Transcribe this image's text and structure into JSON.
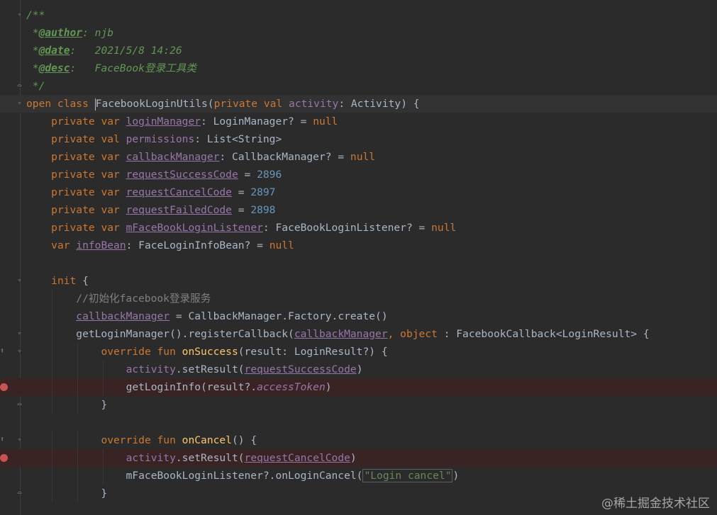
{
  "editor": {
    "lines": [
      {
        "gutter": "fold-top",
        "tokens": [
          [
            "doc",
            "/**"
          ]
        ]
      },
      {
        "tokens": [
          [
            "doc",
            " *"
          ],
          [
            "doctag",
            "@author"
          ],
          [
            "doc",
            ": njb"
          ]
        ]
      },
      {
        "tokens": [
          [
            "doc",
            " *"
          ],
          [
            "doctag",
            "@date"
          ],
          [
            "doc",
            ":   2021/5/8 14:26"
          ]
        ]
      },
      {
        "tokens": [
          [
            "doc",
            " *"
          ],
          [
            "doctag",
            "@desc"
          ],
          [
            "doc",
            ":   FaceBook登录工具类"
          ]
        ]
      },
      {
        "gutter": "fold-bottom",
        "tokens": [
          [
            "doc",
            " */"
          ]
        ]
      },
      {
        "gutter": "fold-top",
        "caret": true,
        "tokens": [
          [
            "kw",
            "open class "
          ],
          [
            "caret",
            ""
          ],
          [
            "plain",
            "FacebookLoginUtils("
          ],
          [
            "kw",
            "private val "
          ],
          [
            "fld",
            "activity"
          ],
          [
            "plain",
            ": Activity) {"
          ]
        ]
      },
      {
        "tokens": [
          [
            "plain",
            "    "
          ],
          [
            "kw",
            "private var "
          ],
          [
            "fldu",
            "loginManager"
          ],
          [
            "plain",
            ": LoginManager? = "
          ],
          [
            "kw",
            "null"
          ]
        ]
      },
      {
        "tokens": [
          [
            "plain",
            "    "
          ],
          [
            "kw",
            "private val "
          ],
          [
            "fld",
            "permissions"
          ],
          [
            "plain",
            ": List<String>"
          ]
        ]
      },
      {
        "tokens": [
          [
            "plain",
            "    "
          ],
          [
            "kw",
            "private var "
          ],
          [
            "fldu",
            "callbackManager"
          ],
          [
            "plain",
            ": CallbackManager? = "
          ],
          [
            "kw",
            "null"
          ]
        ]
      },
      {
        "tokens": [
          [
            "plain",
            "    "
          ],
          [
            "kw",
            "private var "
          ],
          [
            "fldu",
            "requestSuccessCode"
          ],
          [
            "plain",
            " = "
          ],
          [
            "num",
            "2896"
          ]
        ]
      },
      {
        "tokens": [
          [
            "plain",
            "    "
          ],
          [
            "kw",
            "private var "
          ],
          [
            "fldu",
            "requestCancelCode"
          ],
          [
            "plain",
            " = "
          ],
          [
            "num",
            "2897"
          ]
        ]
      },
      {
        "tokens": [
          [
            "plain",
            "    "
          ],
          [
            "kw",
            "private var "
          ],
          [
            "fldu",
            "requestFailedCode"
          ],
          [
            "plain",
            " = "
          ],
          [
            "num",
            "2898"
          ]
        ]
      },
      {
        "tokens": [
          [
            "plain",
            "    "
          ],
          [
            "kw",
            "private var "
          ],
          [
            "fldu",
            "mFaceBookLoginListener"
          ],
          [
            "plain",
            ": FaceBookLoginListener? = "
          ],
          [
            "kw",
            "null"
          ]
        ]
      },
      {
        "tokens": [
          [
            "plain",
            "    "
          ],
          [
            "kw",
            "var "
          ],
          [
            "fldu",
            "infoBean"
          ],
          [
            "plain",
            ": FaceLoginInfoBean? = "
          ],
          [
            "kw",
            "null"
          ]
        ]
      },
      {
        "tokens": []
      },
      {
        "gutter": "fold-top",
        "tokens": [
          [
            "plain",
            "    "
          ],
          [
            "kw",
            "init"
          ],
          [
            "plain",
            " {"
          ]
        ]
      },
      {
        "tokens": [
          [
            "plain",
            "        "
          ],
          [
            "cmt",
            "//初始化facebook登录服务"
          ]
        ]
      },
      {
        "tokens": [
          [
            "plain",
            "        "
          ],
          [
            "fldu",
            "callbackManager"
          ],
          [
            "plain",
            " = CallbackManager.Factory.create()"
          ]
        ]
      },
      {
        "gutter": "fold-top",
        "tokens": [
          [
            "plain",
            "        getLoginManager().registerCallback("
          ],
          [
            "fldu",
            "callbackManager"
          ],
          [
            "kw",
            ", object "
          ],
          [
            "plain",
            ": FacebookCallback<LoginResult> {"
          ]
        ]
      },
      {
        "gutter": "fold-top",
        "override": true,
        "tokens": [
          [
            "plain",
            "            "
          ],
          [
            "kw",
            "override fun "
          ],
          [
            "fn",
            "onSuccess"
          ],
          [
            "plain",
            "(result: LoginResult?) {"
          ]
        ]
      },
      {
        "tokens": [
          [
            "plain",
            "                "
          ],
          [
            "fld",
            "activity"
          ],
          [
            "plain",
            ".setResult("
          ],
          [
            "fldu",
            "requestSuccessCode"
          ],
          [
            "plain",
            ")"
          ]
        ]
      },
      {
        "breakpoint": true,
        "tokens": [
          [
            "plain",
            "                getLoginInfo(result?."
          ],
          [
            "fldit",
            "accessToken"
          ],
          [
            "plain",
            ")"
          ]
        ]
      },
      {
        "gutter": "fold-bottom",
        "tokens": [
          [
            "plain",
            "            }"
          ]
        ]
      },
      {
        "tokens": []
      },
      {
        "gutter": "fold-top",
        "override": true,
        "tokens": [
          [
            "plain",
            "            "
          ],
          [
            "kw",
            "override fun "
          ],
          [
            "fn",
            "onCancel"
          ],
          [
            "plain",
            "() {"
          ]
        ]
      },
      {
        "breakpoint": true,
        "tokens": [
          [
            "plain",
            "                "
          ],
          [
            "fld",
            "activity"
          ],
          [
            "plain",
            ".setResult("
          ],
          [
            "fldu",
            "requestCancelCode"
          ],
          [
            "plain",
            ")"
          ]
        ]
      },
      {
        "tokens": [
          [
            "plain",
            "                mFaceBookLoginListener?.onLoginCancel("
          ],
          [
            "strbox",
            "\"Login cancel\""
          ],
          [
            "plain",
            ")"
          ]
        ]
      },
      {
        "gutter": "fold-bottom",
        "tokens": [
          [
            "plain",
            "            }"
          ]
        ]
      }
    ]
  },
  "watermark": "@稀土掘金技术社区",
  "colors": {
    "background": "#2b2b2b",
    "keyword": "#cc7832",
    "field": "#9876aa",
    "number": "#6897bb",
    "function": "#ffc66d",
    "doc_comment": "#629755",
    "comment": "#808080",
    "string": "#6a8759",
    "breakpoint": "#c75450"
  }
}
